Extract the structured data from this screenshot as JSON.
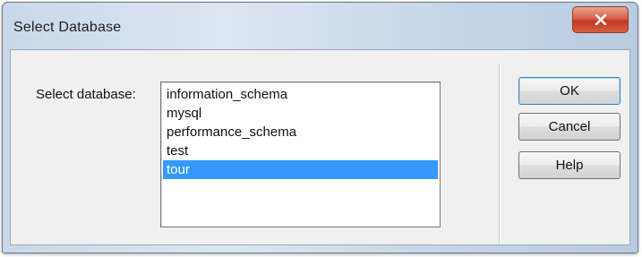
{
  "window": {
    "title": "Select Database"
  },
  "icons": {
    "close": "close-x-icon"
  },
  "form": {
    "label": "Select database:",
    "databases": [
      "information_schema",
      "mysql",
      "performance_schema",
      "test",
      "tour"
    ],
    "selected": "tour"
  },
  "buttons": {
    "ok": "OK",
    "cancel": "Cancel",
    "help": "Help"
  },
  "colors": {
    "selection": "#3399ff",
    "close_button": "#c23a22"
  }
}
